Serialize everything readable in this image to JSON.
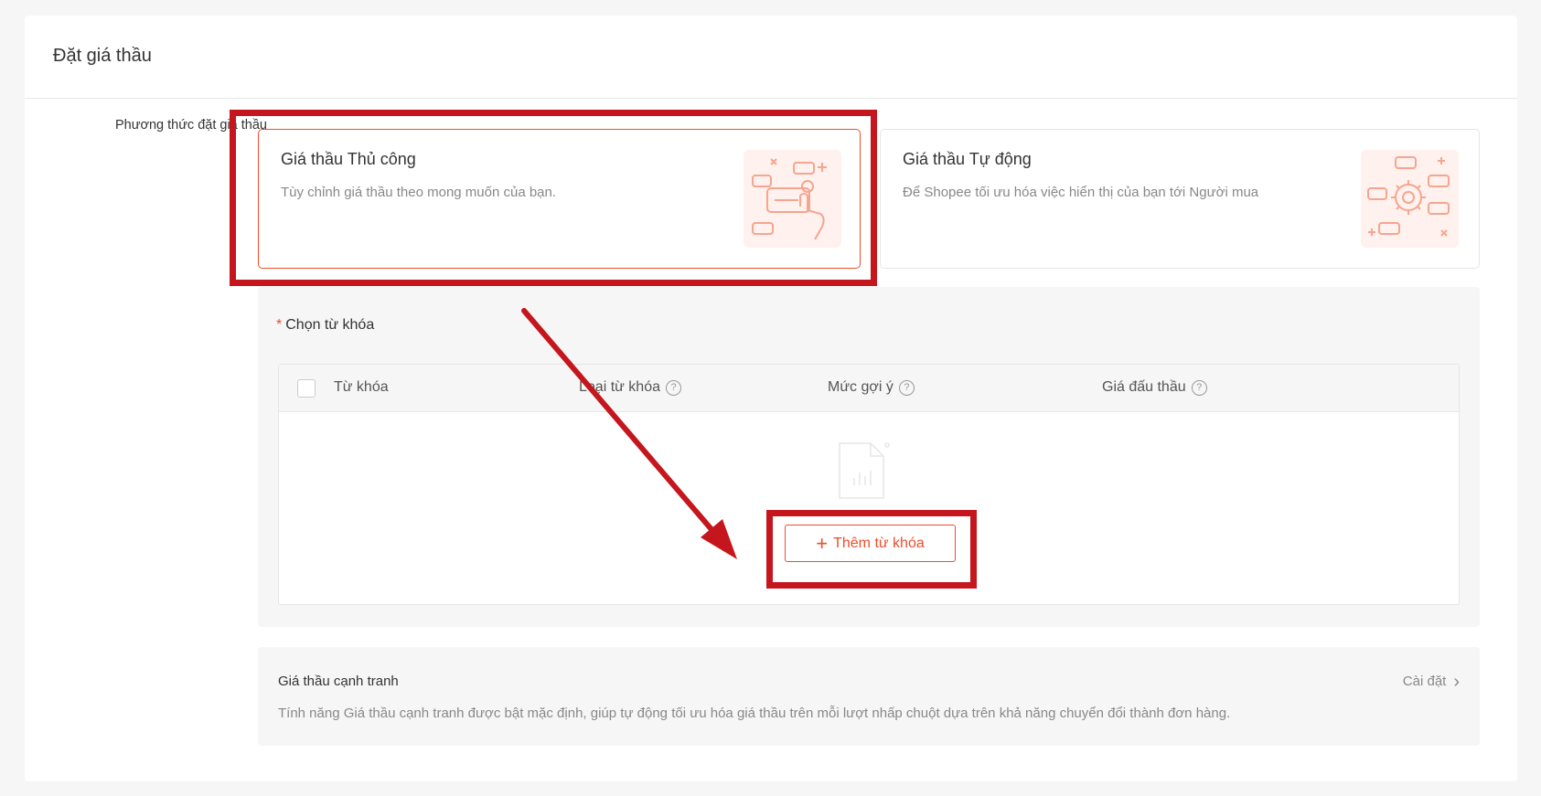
{
  "section": {
    "title": "Đặt giá thầu",
    "method_label": "Phương thức đặt giá thầu"
  },
  "bid_methods": [
    {
      "title": "Giá thầu Thủ công",
      "description": "Tùy chỉnh giá thầu theo mong muốn của bạn.",
      "selected": true,
      "icon": "hand-click-illustration"
    },
    {
      "title": "Giá thầu Tự động",
      "description": "Để Shopee tối ưu hóa việc hiển thị của bạn tới Người mua",
      "selected": false,
      "icon": "gear-illustration"
    }
  ],
  "keywords": {
    "required_mark": "*",
    "label": "Chọn từ khóa",
    "columns": [
      "Từ khóa",
      "Loại từ khóa",
      "Mức gợi ý",
      "Giá đấu thầu"
    ],
    "help_glyph": "?",
    "empty_icon": "empty-document-icon",
    "add_button_icon": "+",
    "add_button_label": "Thêm từ khóa"
  },
  "competitive": {
    "title": "Giá thầu cạnh tranh",
    "setting_label": "Cài đặt",
    "setting_chevron": "›",
    "description": "Tính năng Giá thầu cạnh tranh được bật mặc định, giúp tự động tối ưu hóa giá thầu trên mỗi lượt nhấp chuột dựa trên khả năng chuyển đổi thành đơn hàng."
  },
  "colors": {
    "accent": "#ee4d2d",
    "annotation": "#c4161c",
    "background": "#f6f6f6"
  }
}
